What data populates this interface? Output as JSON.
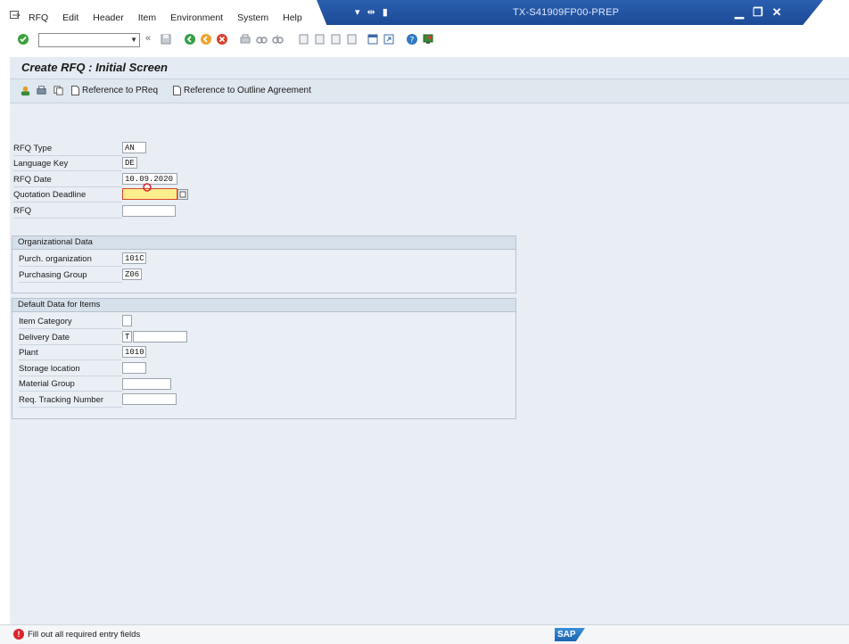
{
  "menubar": {
    "items": [
      "RFQ",
      "Edit",
      "Header",
      "Item",
      "Environment",
      "System",
      "Help"
    ]
  },
  "title_bar": {
    "system": "TX-S41909FP00-PREP"
  },
  "screen": {
    "title": "Create RFQ : Initial Screen"
  },
  "app_toolbar": {
    "ref_preq": "Reference to PReq",
    "ref_outline": "Reference to Outline Agreement"
  },
  "header_fields": {
    "rfq_type_label": "RFQ Type",
    "rfq_type_value": "AN",
    "language_key_label": "Language Key",
    "language_key_value": "DE",
    "rfq_date_label": "RFQ Date",
    "rfq_date_value": "10.09.2020",
    "quotation_deadline_label": "Quotation Deadline",
    "quotation_deadline_value": "",
    "rfq_label": "RFQ",
    "rfq_value": ""
  },
  "org_data": {
    "title": "Organizational Data",
    "purch_org_label": "Purch. organization",
    "purch_org_value": "101C",
    "purch_group_label": "Purchasing Group",
    "purch_group_value": "Z06"
  },
  "default_data": {
    "title": "Default Data for Items",
    "item_category_label": "Item Category",
    "item_category_value": "",
    "delivery_date_label": "Delivery Date",
    "delivery_date_type": "T",
    "delivery_date_value": "",
    "plant_label": "Plant",
    "plant_value": "1010",
    "storage_location_label": "Storage location",
    "storage_location_value": "",
    "material_group_label": "Material Group",
    "material_group_value": "",
    "req_tracking_label": "Req. Tracking Number",
    "req_tracking_value": ""
  },
  "status": {
    "message": "Fill out all required entry fields",
    "logo": "SAP"
  },
  "colors": {
    "title_strip": "#1b4a96",
    "active_field": "#fbee8c",
    "error_red": "#d8262b"
  }
}
